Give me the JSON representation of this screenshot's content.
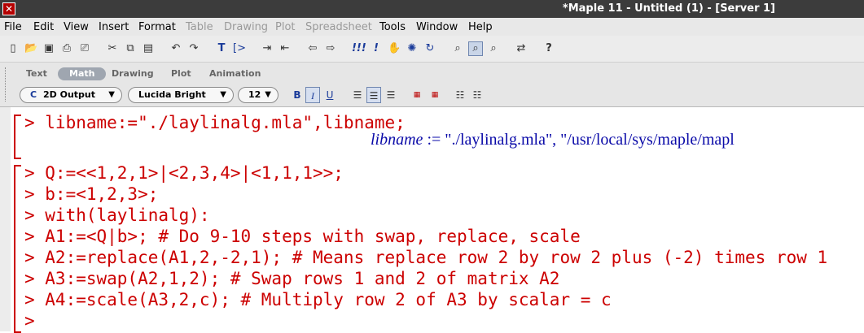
{
  "window": {
    "title": "*Maple 11 - Untitled (1) - [Server 1]"
  },
  "menu": [
    "File",
    "Edit",
    "View",
    "Insert",
    "Format",
    "Table",
    "Drawing",
    "Plot",
    "Spreadsheet",
    "Tools",
    "Window",
    "Help"
  ],
  "disabled_menu": [
    "Table",
    "Drawing",
    "Plot",
    "Spreadsheet"
  ],
  "toolbar_icons": [
    "new-icon",
    "open-icon",
    "save-icon",
    "print-icon",
    "print-preview-icon",
    "cut-icon",
    "copy-icon",
    "paste-icon",
    "undo-icon",
    "redo-icon",
    "text-icon",
    "prompt-icon",
    "indent-icon",
    "outdent-icon",
    "back-icon",
    "forward-icon",
    "execute-all-icon",
    "execute-icon",
    "stop-icon",
    "debug-icon",
    "restart-icon",
    "zoom-100-icon",
    "zoom-150-icon",
    "zoom-200-icon",
    "toggle-icon",
    "help-icon"
  ],
  "context_bar": {
    "tabs": [
      "Text",
      "Math",
      "Drawing",
      "Plot",
      "Animation"
    ],
    "active_tab": "Math",
    "style_combo": "2D Output",
    "style_prefix": "C",
    "font_combo": "Lucida Bright",
    "size_combo": "12",
    "format_buttons": {
      "bold": "B",
      "italic": "I",
      "underline": "U"
    }
  },
  "worksheet": {
    "group1": {
      "input": "> libname:=\"./laylinalg.mla\",libname;",
      "output_var": "libname",
      "output_rest": " := \"./laylinalg.mla\", \"/usr/local/sys/maple/mapl"
    },
    "group2": [
      "> Q:=<<1,2,1>|<2,3,4>|<1,1,1>>;",
      "> b:=<1,2,3>;",
      "> with(laylinalg):",
      "> A1:=<Q|b>; # Do 9-10 steps with swap, replace, scale",
      "> A2:=replace(A1,2,-2,1); # Means replace row 2 by row 2 plus (-2) times row 1",
      "> A3:=swap(A2,1,2); # Swap rows 1 and 2 of matrix A2",
      "> A4:=scale(A3,2,c); # Multiply row 2 of A3 by scalar = c",
      ">"
    ]
  },
  "colors": {
    "input": "#cc0000",
    "output": "#0a0aa8",
    "title_bg": "#3c3c3c"
  }
}
